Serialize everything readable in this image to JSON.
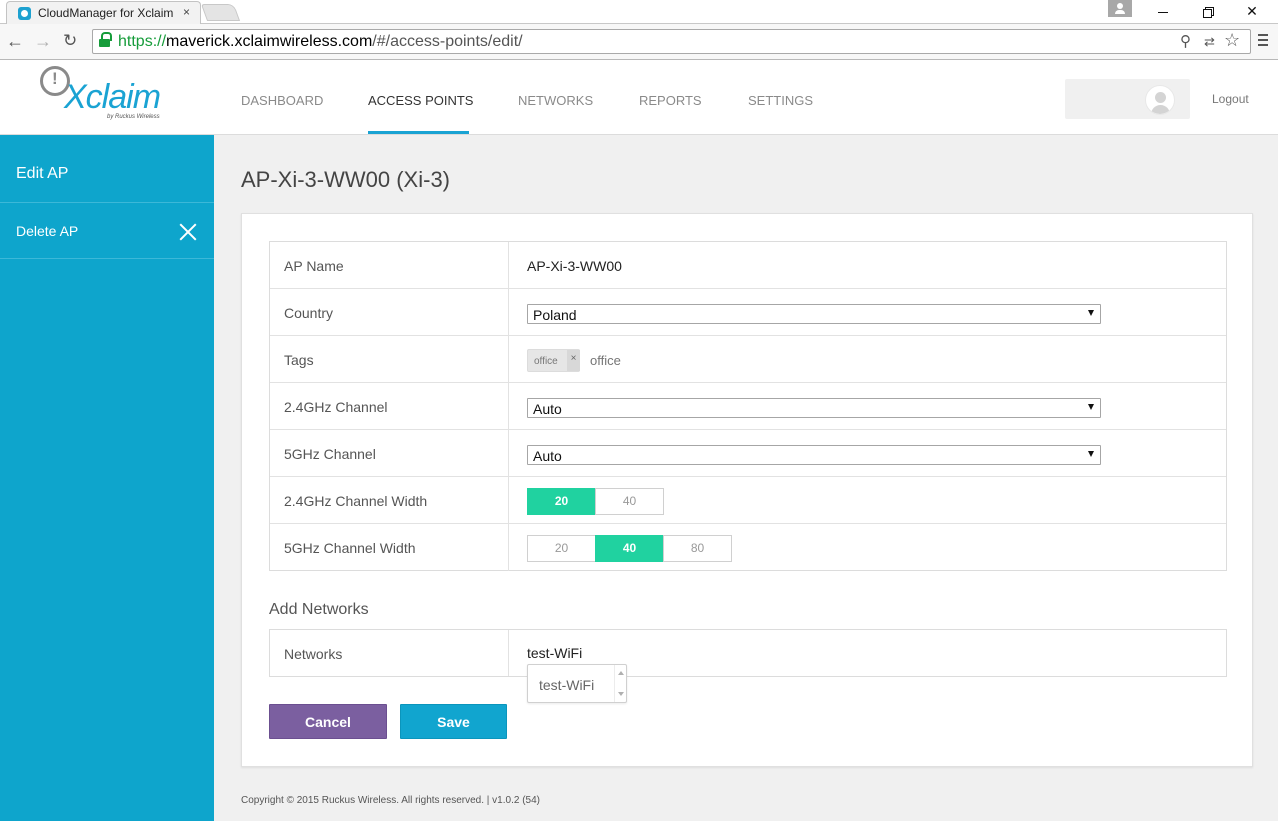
{
  "browser": {
    "tab_title": "CloudManager for Xclaim",
    "tab_close": "×",
    "url_scheme": "https://",
    "url_host": "maverick.xclaimwireless.com",
    "url_path": "/#/access-points/edit/"
  },
  "header": {
    "logo_text": "Xclaim",
    "logo_subtext": "by Ruckus Wireless",
    "nav": [
      {
        "label": "DASHBOARD",
        "active": false
      },
      {
        "label": "ACCESS POINTS",
        "active": true
      },
      {
        "label": "NETWORKS",
        "active": false
      },
      {
        "label": "REPORTS",
        "active": false
      },
      {
        "label": "SETTINGS",
        "active": false
      }
    ],
    "logout_label": "Logout"
  },
  "sidebar": {
    "items": [
      {
        "label": "Edit AP"
      },
      {
        "label": "Delete AP"
      }
    ]
  },
  "main": {
    "title": "AP-Xi-3-WW00 (Xi-3)",
    "form": {
      "ap_name": {
        "label": "AP Name",
        "value": "AP-Xi-3-WW00"
      },
      "country": {
        "label": "Country",
        "value": "Poland"
      },
      "tags": {
        "label": "Tags",
        "chip": "office",
        "chip_remove": "×",
        "placeholder": "office"
      },
      "channel_24": {
        "label": "2.4GHz Channel",
        "value": "Auto"
      },
      "channel_5": {
        "label": "5GHz Channel",
        "value": "Auto"
      },
      "width_24": {
        "label": "2.4GHz Channel Width",
        "options": [
          "20",
          "40"
        ],
        "selected": "20"
      },
      "width_5": {
        "label": "5GHz Channel Width",
        "options": [
          "20",
          "40",
          "80"
        ],
        "selected": "40"
      }
    },
    "add_networks": {
      "title": "Add Networks",
      "label": "Networks",
      "value": "test-WiFi",
      "suggestion": "test-WiFi"
    },
    "buttons": {
      "cancel": "Cancel",
      "save": "Save"
    }
  },
  "footer": {
    "copyright": "Copyright © 2015 Ruckus Wireless. All rights reserved. | v1.0.2 (54)"
  },
  "colors": {
    "brand": "#1aa3d3",
    "sidebar": "#0ea5cc",
    "toggle_on": "#20d2a0",
    "cancel": "#7b5fa0",
    "save": "#11a5cf"
  }
}
